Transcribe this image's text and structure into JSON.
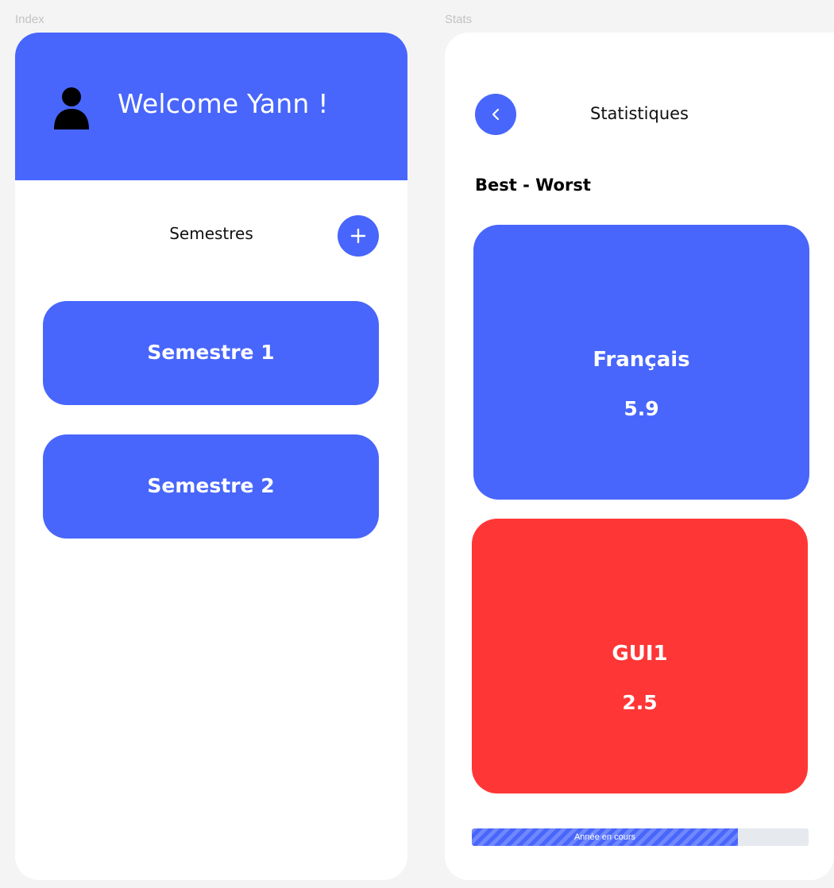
{
  "frames": {
    "index_label": "Index",
    "stats_label": "Stats"
  },
  "index": {
    "welcome_text": "Welcome Yann !",
    "user_icon": "user-icon",
    "semestres_title": "Semestres",
    "add_icon": "plus-icon",
    "semesters": [
      {
        "label": "Semestre 1"
      },
      {
        "label": "Semestre 2"
      }
    ]
  },
  "stats": {
    "back_icon": "chevron-left-icon",
    "title": "Statistiques",
    "section_heading": "Best - Worst",
    "best": {
      "subject": "Français",
      "grade": "5.9"
    },
    "worst": {
      "subject": "GUI1",
      "grade": "2.5"
    },
    "progress": {
      "label": "Année en cours",
      "value_percent": 79
    }
  },
  "colors": {
    "primary": "#4866fb",
    "danger": "#ff3636",
    "background": "#f4f4f4",
    "card_background": "#ffffff",
    "progress_track": "#e6e9ee"
  }
}
